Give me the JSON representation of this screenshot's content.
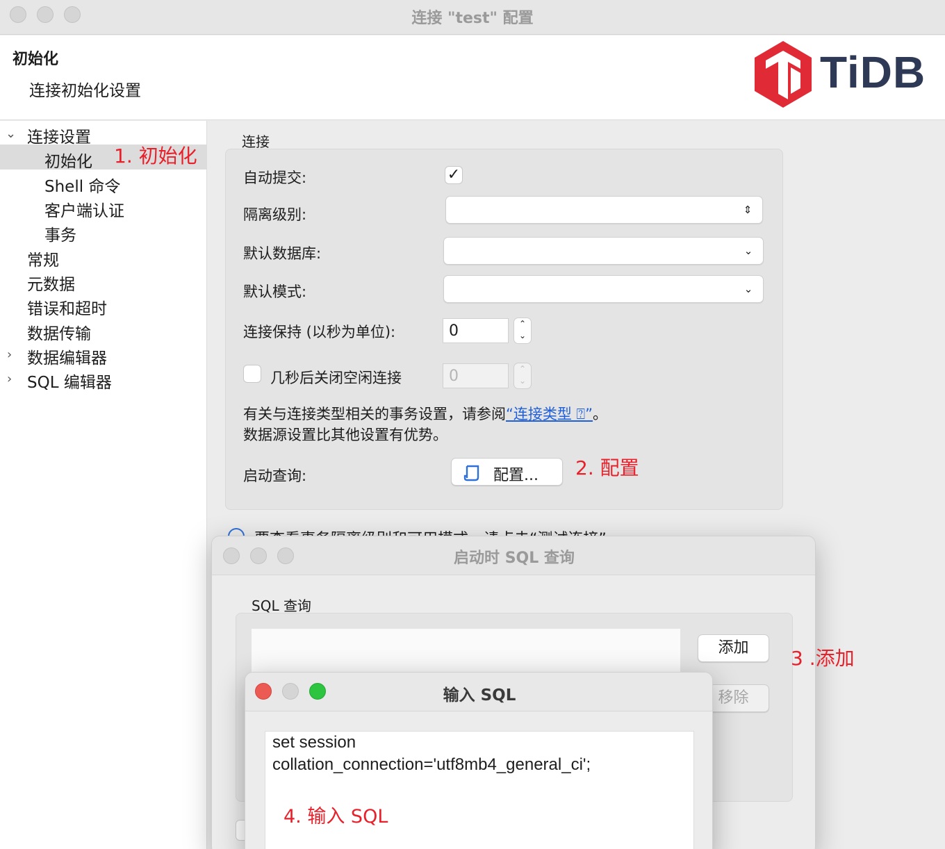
{
  "window": {
    "title": "连接 \"test\" 配置"
  },
  "header": {
    "title": "初始化",
    "subtitle": "连接初始化设置",
    "logo_text": "TiDB"
  },
  "sidebar": {
    "items": [
      {
        "label": "连接设置"
      },
      {
        "label": "初始化"
      },
      {
        "label": "Shell 命令"
      },
      {
        "label": "客户端认证"
      },
      {
        "label": "事务"
      },
      {
        "label": "常规"
      },
      {
        "label": "元数据"
      },
      {
        "label": "错误和超时"
      },
      {
        "label": "数据传输"
      },
      {
        "label": "数据编辑器"
      },
      {
        "label": "SQL 编辑器"
      }
    ]
  },
  "connection": {
    "group_label": "连接",
    "auto_commit_label": "自动提交:",
    "auto_commit_checked": true,
    "isolation_label": "隔离级别:",
    "isolation_value": "",
    "default_db_label": "默认数据库:",
    "default_db_value": "",
    "default_schema_label": "默认模式:",
    "default_schema_value": "",
    "keepalive_label": "连接保持 (以秒为单位):",
    "keepalive_value": "0",
    "close_idle_label": "几秒后关闭空闲连接",
    "close_idle_value": "0",
    "info_line1_prefix": "有关与连接类型相关的事务设置，请参阅",
    "info_link": "“连接类型 ⍰”",
    "info_line1_suffix": "。",
    "info_line2": "数据源设置比其他设置有优势。",
    "startup_query_label": "启动查询:",
    "configure_button": "配置...",
    "hint_text": "要查看事务隔离级别和可用模式，请点击“测试连接”"
  },
  "startup_dialog": {
    "title": "启动时 SQL 查询",
    "group_label": "SQL 查询",
    "add_button": "添加",
    "remove_button": "移除"
  },
  "sql_dialog": {
    "title": "输入 SQL",
    "sql_line1": "set session",
    "sql_line2": "collation_connection='utf8mb4_general_ci';"
  },
  "annotations": {
    "step1": "1. 初始化",
    "step2": "2. 配置",
    "step3": "3 .添加",
    "step4": "4. 输入 SQL"
  },
  "colors": {
    "annotation": "#e8202a",
    "link": "#1f5fd8",
    "logo_red": "#e02a36",
    "logo_text": "#2e3a55",
    "close": "#ec5b53",
    "minimize": "#d8d8d8",
    "zoom": "#2dc43f"
  }
}
